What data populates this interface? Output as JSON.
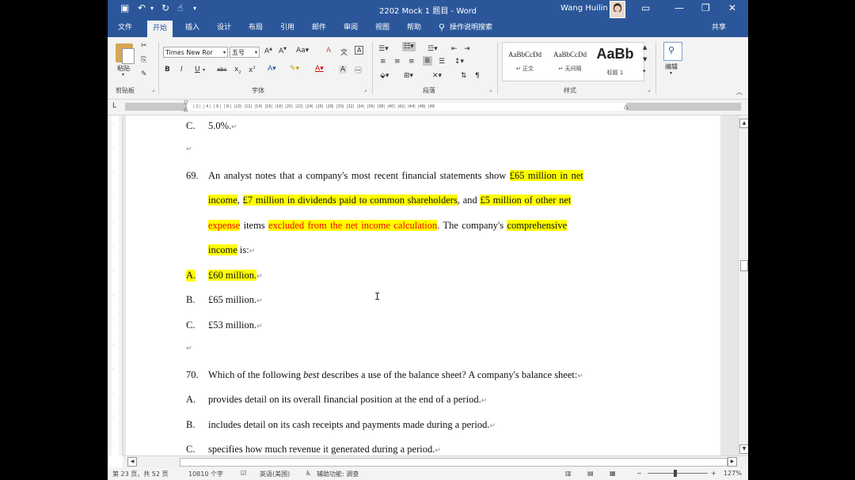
{
  "titlebar": {
    "doc_title": "2202 Mock 1 题目  -  Word",
    "user": "Wang Huilin",
    "quick_access": [
      "save-icon",
      "undo-icon",
      "redo-icon",
      "touch-mode-icon",
      "customize-icon"
    ]
  },
  "tabs": [
    "文件",
    "开始",
    "插入",
    "设计",
    "布局",
    "引用",
    "邮件",
    "审阅",
    "视图",
    "帮助",
    "操作说明搜索",
    "共享"
  ],
  "ribbon": {
    "clipboard": {
      "paste": "粘贴",
      "group": "剪贴板"
    },
    "font": {
      "name": "Times New Ror",
      "size": "五号",
      "group": "字体"
    },
    "paragraph": {
      "group": "段落"
    },
    "styles": {
      "group": "样式",
      "items": [
        {
          "sample": "AaBbCcDd",
          "name": "↵ 正文"
        },
        {
          "sample": "AaBbCcDd",
          "name": "↵ 无间隔"
        },
        {
          "sample": "AaBb",
          "name": "标题 1"
        }
      ]
    },
    "editing": {
      "label": "编辑"
    }
  },
  "document": {
    "lines": [
      {
        "num": "C.",
        "text": "5.0%."
      },
      {
        "num": "69.",
        "q1_a": "An analyst notes that a company's most recent financial statements show ",
        "q1_b": "£65 million in net"
      },
      {
        "q2_a": "income",
        "q2_b": ", ",
        "q2_c": "£7 million in dividends paid to common shareholders",
        "q2_d": ", and ",
        "q2_e": "£5 million of other net"
      },
      {
        "q3_a": "expense",
        "q3_b": " items ",
        "q3_c": "excluded from the net income calculation",
        "q3_d": ". The company's ",
        "q3_e": "comprehensive"
      },
      {
        "q4_a": "income",
        "q4_b": " is:"
      },
      {
        "num": "A.",
        "text": "£60 million."
      },
      {
        "num": "B.",
        "text": "£65 million."
      },
      {
        "num": "C.",
        "text": "£53 million."
      },
      {
        "num": "70.",
        "text_a": "Which of the following ",
        "text_b": "best",
        "text_c": " describes a use of the balance sheet? A company's balance sheet:"
      },
      {
        "num": "A.",
        "text": "provides detail on its overall financial position at the end of a period."
      },
      {
        "num": "B.",
        "text": "includes detail on its cash receipts and payments made during a period."
      },
      {
        "num": "C.",
        "text": "specifies how much revenue it generated during a period."
      }
    ]
  },
  "status": {
    "page": "第 23 页，共 52 页",
    "words": "10810 个字",
    "lang": "英语(美国)",
    "accessibility": "辅助功能: 调查",
    "zoom": "127%"
  }
}
